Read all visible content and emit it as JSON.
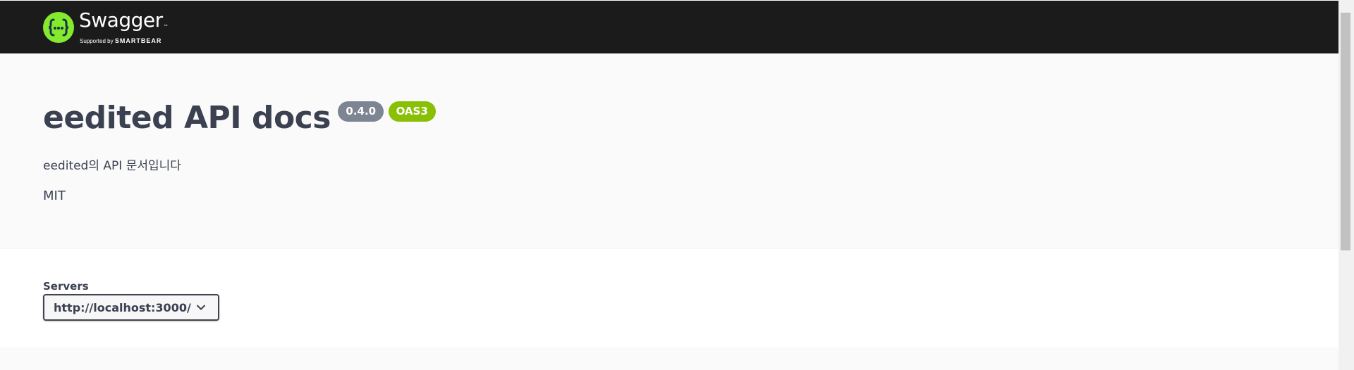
{
  "header": {
    "logo_title": "Swagger",
    "logo_tm": "™",
    "logo_supported_prefix": "Supported by",
    "logo_supported_brand": "SMARTBEAR",
    "logo_color": "#85ea2d",
    "background_color": "#1b1b1b"
  },
  "info": {
    "title": "eedited API docs",
    "version": "0.4.0",
    "oas_badge": "OAS3",
    "description": "eedited의 API 문서입니다",
    "license": "MIT"
  },
  "servers": {
    "label": "Servers",
    "selected": "http://localhost:3000/"
  },
  "icons": {
    "logo": "swagger-logo-icon",
    "dropdown": "chevron-down-icon"
  }
}
